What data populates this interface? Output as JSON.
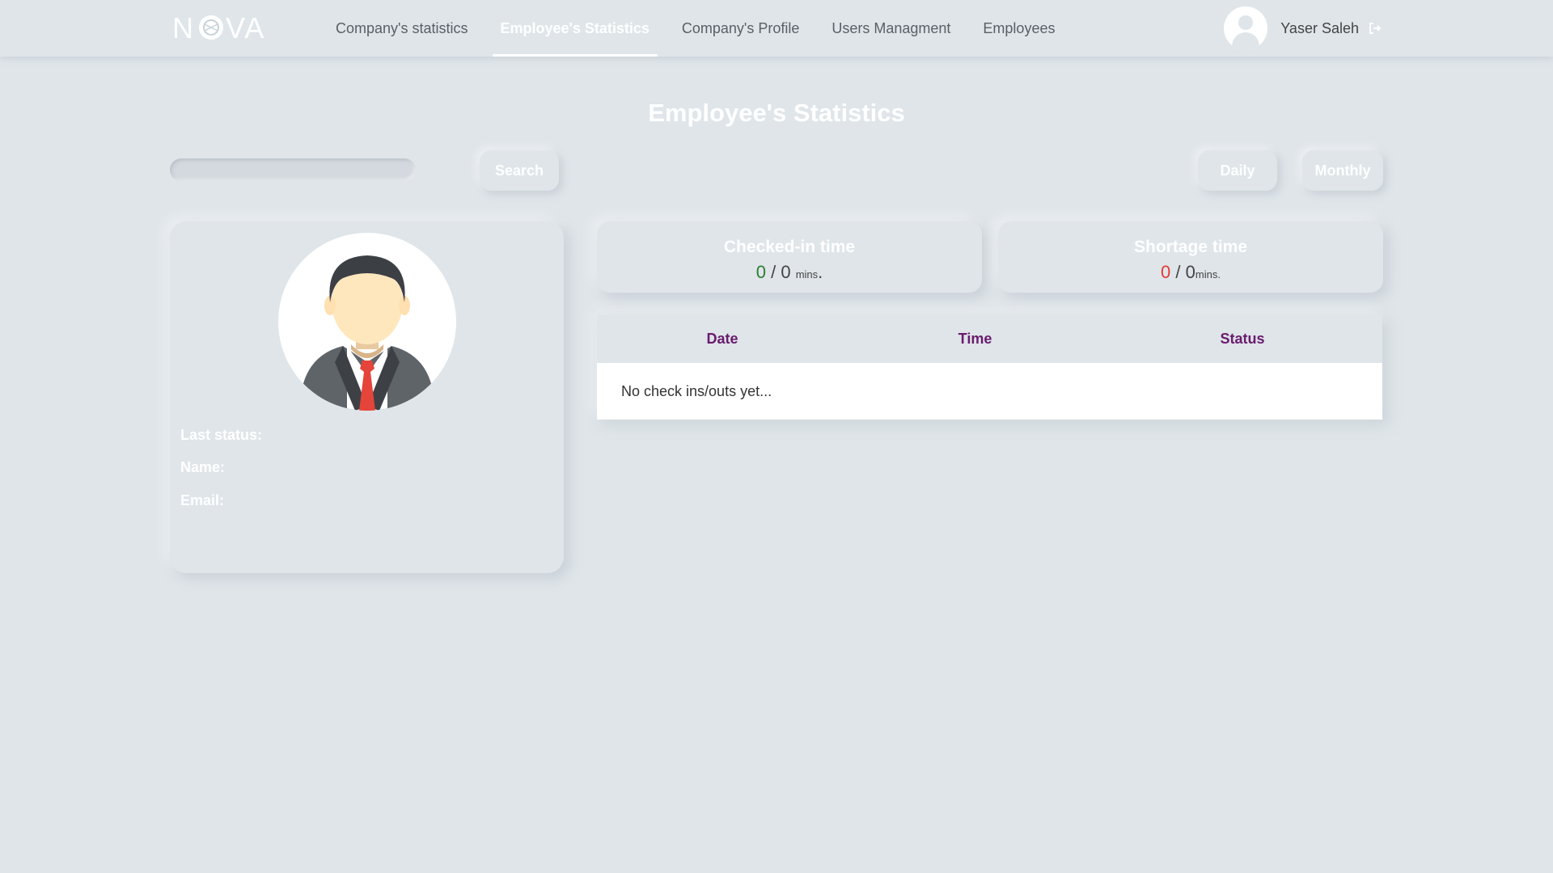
{
  "app": {
    "logo_text": "NOVA"
  },
  "nav": {
    "items": [
      {
        "label": "Company's statistics",
        "active": false
      },
      {
        "label": "Employee's Statistics",
        "active": true
      },
      {
        "label": "Company's Profile",
        "active": false
      },
      {
        "label": "Users Managment",
        "active": false
      },
      {
        "label": "Employees",
        "active": false
      }
    ],
    "user_name": "Yaser Saleh",
    "logout_icon": "sign-out-icon"
  },
  "page": {
    "title": "Employee's Statistics"
  },
  "toolbar": {
    "search_placeholder": "",
    "search_label": "Search",
    "daily_label": "Daily",
    "monthly_label": "Monthly"
  },
  "profile": {
    "last_status_label": "Last status:",
    "name_label": "Name:",
    "email_label": "Email:"
  },
  "stats": {
    "checked_in": {
      "title": "Checked-in time",
      "value": "0",
      "separator": "/",
      "total": "0",
      "unit": "mins",
      "suffix": "."
    },
    "shortage": {
      "title": "Shortage time",
      "value": "0",
      "separator": "/",
      "total": "0",
      "unit": "mins."
    }
  },
  "table": {
    "headers": [
      "Date",
      "Time",
      "Status"
    ],
    "empty_message": "No check ins/outs yet..."
  },
  "colors": {
    "background": "#dfe5e9",
    "header_text": "#6a1b6e",
    "value_green": "#2e7d32",
    "value_red": "#e53935"
  }
}
